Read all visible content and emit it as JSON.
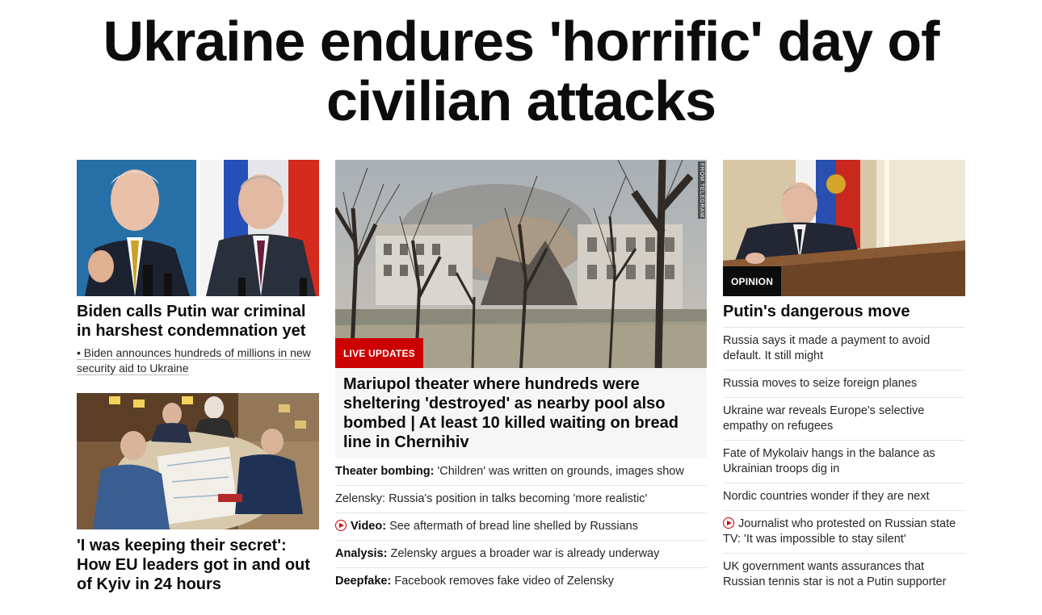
{
  "main_headline": "Ukraine endures 'horrific' day of civilian attacks",
  "left": {
    "story1": {
      "title": "Biden calls Putin war criminal in harshest condemnation yet",
      "sub": "• Biden announces hundreds of millions in new security aid to Ukraine"
    },
    "story2": {
      "title": "'I was keeping their secret': How EU leaders got in and out of Kyiv in 24 hours"
    }
  },
  "middle": {
    "label": "LIVE UPDATES",
    "photo_credit": "FROM TELEGRAM",
    "title": "Mariupol theater where hundreds were sheltering 'destroyed' as nearby pool also bombed | At least 10 killed waiting on bread line in Chernihiv",
    "links": [
      {
        "prefix": "Theater bombing:",
        "text": " 'Children' was written on grounds, images show",
        "video": false
      },
      {
        "prefix": "",
        "text": "Zelensky: Russia's position in talks becoming 'more realistic'",
        "video": false
      },
      {
        "prefix": "Video:",
        "text": " See aftermath of bread line shelled by Russians",
        "video": true
      },
      {
        "prefix": "Analysis:",
        "text": " Zelensky argues a broader war is already underway",
        "video": false
      },
      {
        "prefix": "Deepfake:",
        "text": " Facebook removes fake video of Zelensky",
        "video": false
      }
    ]
  },
  "right": {
    "label": "OPINION",
    "title": "Putin's dangerous move",
    "links": [
      {
        "text": "Russia says it made a payment to avoid default. It still might",
        "video": false
      },
      {
        "text": "Russia moves to seize foreign planes",
        "video": false
      },
      {
        "text": "Ukraine war reveals Europe's selective empathy on refugees",
        "video": false
      },
      {
        "text": "Fate of Mykolaiv hangs in the balance as Ukrainian troops dig in",
        "video": false
      },
      {
        "text": "Nordic countries wonder if they are next",
        "video": false
      },
      {
        "text": "Journalist who protested on Russian state TV: 'It was impossible to stay silent'",
        "video": true
      },
      {
        "text": "UK government wants assurances that Russian tennis star is not a Putin supporter",
        "video": false
      }
    ]
  },
  "colors": {
    "live_red": "#cc0000",
    "text": "#0c0c0c",
    "divider": "#e6e6e6"
  }
}
